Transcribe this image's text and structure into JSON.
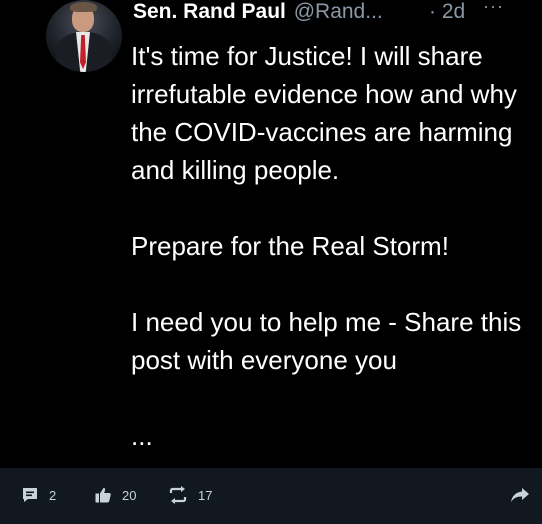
{
  "post": {
    "author_name": "Sen. Rand Paul",
    "author_handle": "@Rand...",
    "timestamp": "· 2d",
    "more_icon": "ellipsis-icon",
    "avatar_icon": "profile-photo",
    "paragraphs": [
      "It's time for Justice! I will share irrefutable evidence how and why the COVID-vaccines are harming and killing people.",
      "Prepare for the Real Storm!",
      "I need you to help me - Share this post with everyone you"
    ],
    "truncation": "..."
  },
  "actions": {
    "comments": {
      "icon": "comment-icon",
      "count": "2"
    },
    "likes": {
      "icon": "thumbs-up-icon",
      "count": "20"
    },
    "reposts": {
      "icon": "repost-icon",
      "count": "17"
    },
    "share": {
      "icon": "share-arrow-icon"
    }
  }
}
